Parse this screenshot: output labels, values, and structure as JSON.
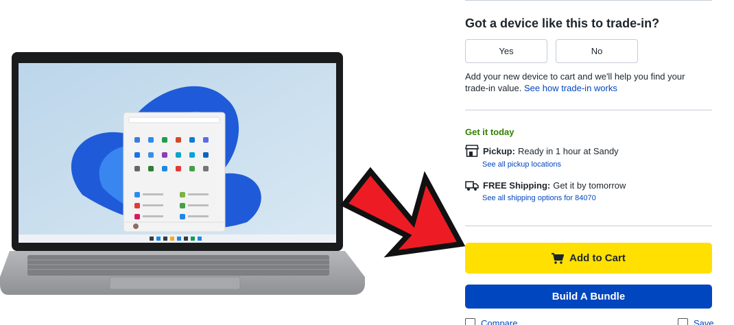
{
  "trade_in": {
    "question": "Got a device like this to trade-in?",
    "yes_label": "Yes",
    "no_label": "No",
    "description": "Add your new device to cart and we'll help you find your trade-in value.",
    "link_label": "See how trade-in works"
  },
  "fulfillment": {
    "heading": "Get it today",
    "pickup": {
      "label": "Pickup:",
      "detail": "Ready in 1 hour at Sandy",
      "link": "See all pickup locations",
      "icon": "store-icon"
    },
    "shipping": {
      "label": "FREE Shipping:",
      "detail": "Get it by tomorrow",
      "link": "See all shipping options for 84070",
      "icon": "truck-icon"
    }
  },
  "actions": {
    "add_to_cart": "Add to Cart",
    "build_bundle": "Build A Bundle",
    "compare": "Compare",
    "save": "Save"
  },
  "colors": {
    "accent_green": "#318000",
    "link_blue": "#0046be",
    "cart_yellow": "#ffe000",
    "arrow_red": "#ed1c24"
  }
}
